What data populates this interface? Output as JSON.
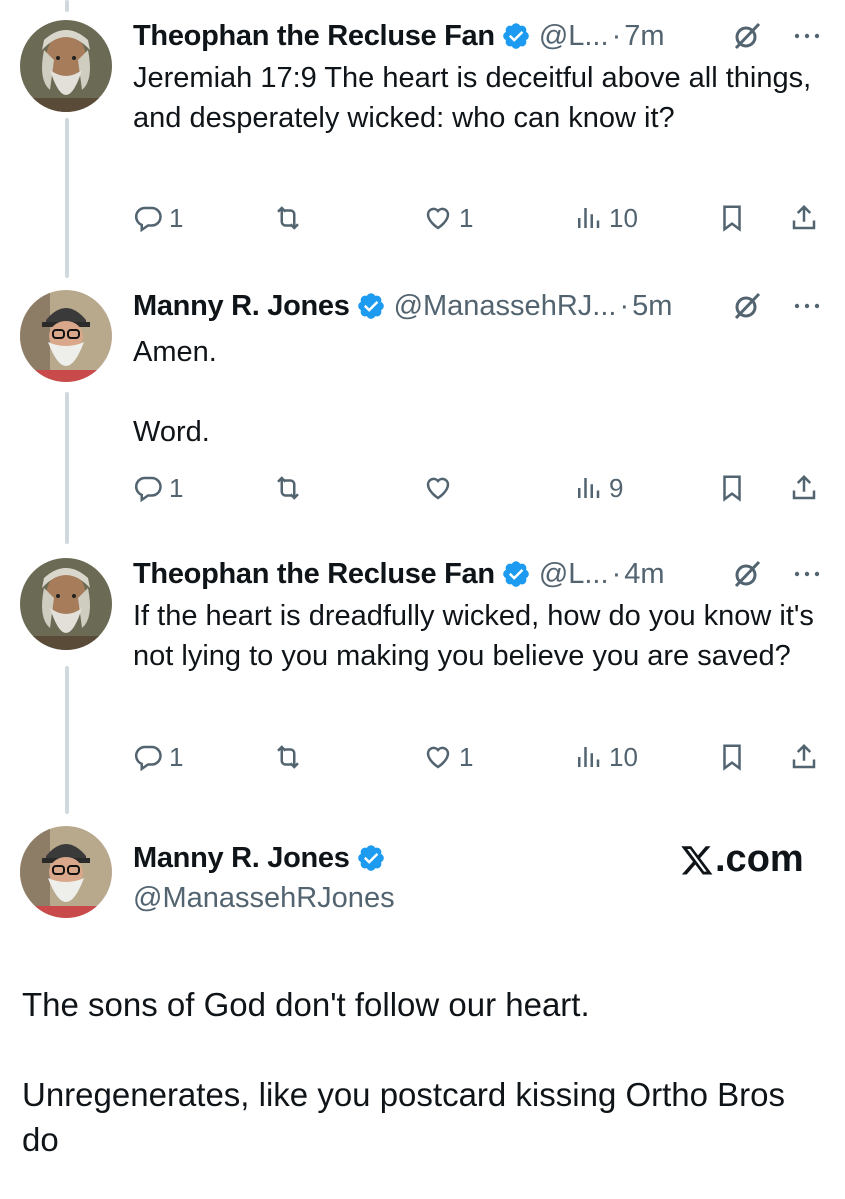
{
  "tweets": [
    {
      "name": "Theophan the Recluse Fan",
      "handle": "@L...",
      "time": "7m",
      "text": "Jeremiah 17:9 The heart is deceitful above all things, and desperately wicked: who can know it?",
      "replies": "1",
      "reposts": "",
      "likes": "1",
      "views": "10"
    },
    {
      "name": "Manny R. Jones",
      "handle": "@ManassehRJ...",
      "time": "5m",
      "text": "Amen.\n\nWord.",
      "replies": "1",
      "reposts": "",
      "likes": "",
      "views": "9"
    },
    {
      "name": "Theophan the Recluse Fan",
      "handle": "@L...",
      "time": "4m",
      "text": "If the heart is dreadfully wicked, how do you know it's not lying to you making you believe you are saved?",
      "replies": "1",
      "reposts": "",
      "likes": "1",
      "views": "10"
    }
  ],
  "main_tweet": {
    "name": "Manny R. Jones",
    "handle": "@ManassehRJones",
    "text": "The sons of God don't follow our heart.\n\nUnregenerates, like you postcard kissing Ortho Bros do"
  },
  "separator": "·",
  "watermark": ".com",
  "colors": {
    "verified": "#1d9bf0",
    "secondary_text": "#536471",
    "thread_line": "#cfd9de"
  }
}
